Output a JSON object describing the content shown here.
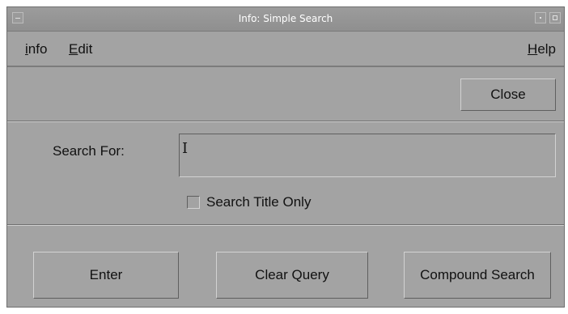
{
  "window": {
    "title": "Info: Simple Search"
  },
  "menubar": {
    "items": [
      {
        "label": "info",
        "mnemonic": "i",
        "rest": "nfo"
      },
      {
        "label": "Edit",
        "mnemonic": "E",
        "rest": "dit"
      },
      {
        "label": "Help",
        "mnemonic": "H",
        "rest": "elp"
      }
    ]
  },
  "toolbar": {
    "close_label": "Close"
  },
  "search": {
    "label": "Search For:",
    "value": "",
    "placeholder": "",
    "cursor_glyph": "I"
  },
  "options": {
    "title_only_label": "Search Title Only",
    "title_only_checked": false
  },
  "actions": {
    "enter_label": "Enter",
    "clear_label": "Clear Query",
    "compound_label": "Compound Search"
  },
  "colors": {
    "window_background": "#a3a3a3",
    "titlebar": "#939393",
    "title_text": "#ffffff"
  },
  "icons": {
    "window_menu": "window-menu-icon",
    "minimize": "minimize-icon",
    "maximize": "maximize-icon"
  }
}
